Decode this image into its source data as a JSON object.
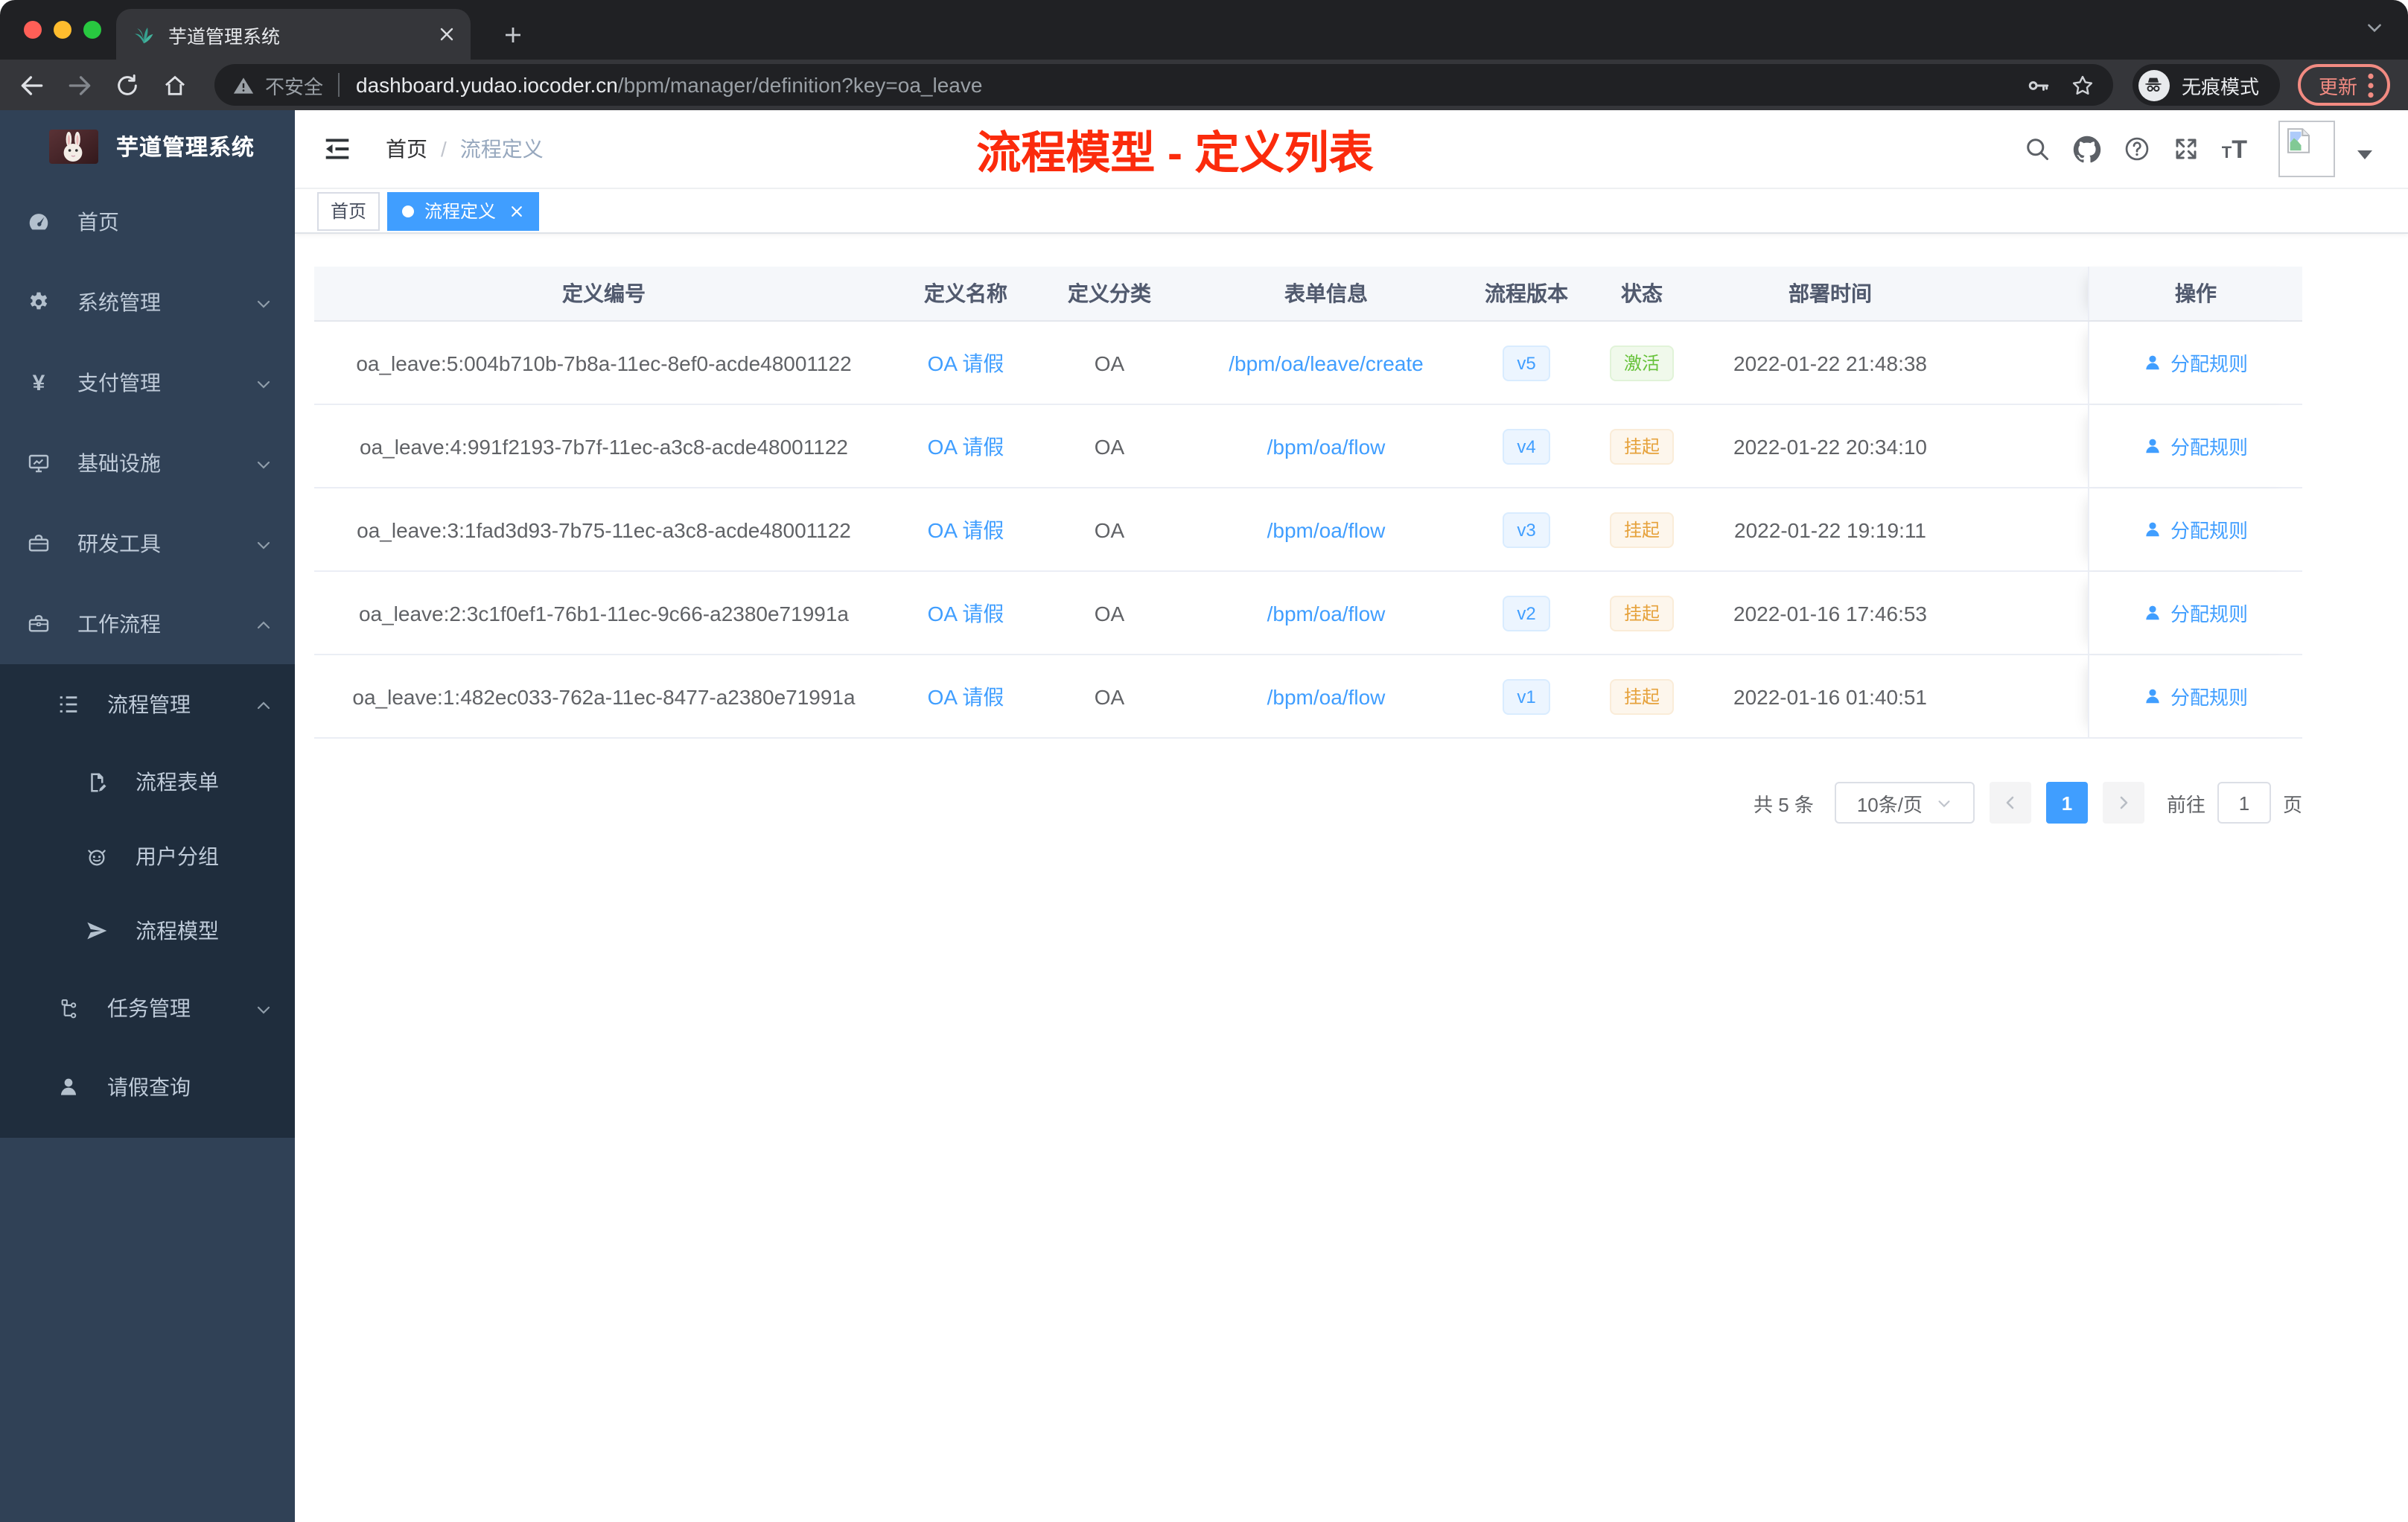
{
  "colors": {
    "accent_blue": "#409eff",
    "sidebar_bg": "#304156",
    "sidebar_submenu_bg": "#1f2d3d",
    "status_active_green": "#67c23a",
    "status_suspend_orange": "#e6a23c",
    "annotation_red": "#fb2b0c",
    "chrome_update_red": "#f28b82"
  },
  "browser": {
    "tab_title": "芋道管理系统",
    "not_secure_label": "不安全",
    "url_host": "dashboard.yudao.iocoder.cn",
    "url_path": "/bpm/manager/definition?key=oa_leave",
    "incognito_label": "无痕模式",
    "update_label": "更新"
  },
  "icons": {
    "yen": "¥",
    "t_small": "T",
    "t_large": "T"
  },
  "sidebar": {
    "app_title": "芋道管理系统",
    "items": [
      {
        "label": "首页"
      },
      {
        "label": "系统管理"
      },
      {
        "label": "支付管理"
      },
      {
        "label": "基础设施"
      },
      {
        "label": "研发工具"
      },
      {
        "label": "工作流程"
      },
      {
        "label": "流程管理"
      },
      {
        "label": "流程表单"
      },
      {
        "label": "用户分组"
      },
      {
        "label": "流程模型"
      },
      {
        "label": "任务管理"
      },
      {
        "label": "请假查询"
      }
    ]
  },
  "header": {
    "breadcrumb_home": "首页",
    "breadcrumb_separator": "/",
    "breadcrumb_current": "流程定义",
    "annotation_title": "流程模型 - 定义列表"
  },
  "tags": {
    "home_label": "首页",
    "active_label": "流程定义"
  },
  "table": {
    "columns": [
      "定义编号",
      "定义名称",
      "定义分类",
      "表单信息",
      "流程版本",
      "状态",
      "部署时间",
      "操作"
    ],
    "action_label": "分配规则",
    "rows": [
      {
        "id": "oa_leave:5:004b710b-7b8a-11ec-8ef0-acde48001122",
        "name": "OA 请假",
        "category": "OA",
        "form": "/bpm/oa/leave/create",
        "version": "v5",
        "status": "激活",
        "time": "2022-01-22 21:48:38"
      },
      {
        "id": "oa_leave:4:991f2193-7b7f-11ec-a3c8-acde48001122",
        "name": "OA 请假",
        "category": "OA",
        "form": "/bpm/oa/flow",
        "version": "v4",
        "status": "挂起",
        "time": "2022-01-22 20:34:10"
      },
      {
        "id": "oa_leave:3:1fad3d93-7b75-11ec-a3c8-acde48001122",
        "name": "OA 请假",
        "category": "OA",
        "form": "/bpm/oa/flow",
        "version": "v3",
        "status": "挂起",
        "time": "2022-01-22 19:19:11"
      },
      {
        "id": "oa_leave:2:3c1f0ef1-76b1-11ec-9c66-a2380e71991a",
        "name": "OA 请假",
        "category": "OA",
        "form": "/bpm/oa/flow",
        "version": "v2",
        "status": "挂起",
        "time": "2022-01-16 17:46:53"
      },
      {
        "id": "oa_leave:1:482ec033-762a-11ec-8477-a2380e71991a",
        "name": "OA 请假",
        "category": "OA",
        "form": "/bpm/oa/flow",
        "version": "v1",
        "status": "挂起",
        "time": "2022-01-16 01:40:51"
      }
    ]
  },
  "pagination": {
    "total_label": "共 5 条",
    "page_size_label": "10条/页",
    "current_page": "1",
    "goto_label": "前往",
    "goto_value": "1",
    "page_unit_label": "页"
  }
}
